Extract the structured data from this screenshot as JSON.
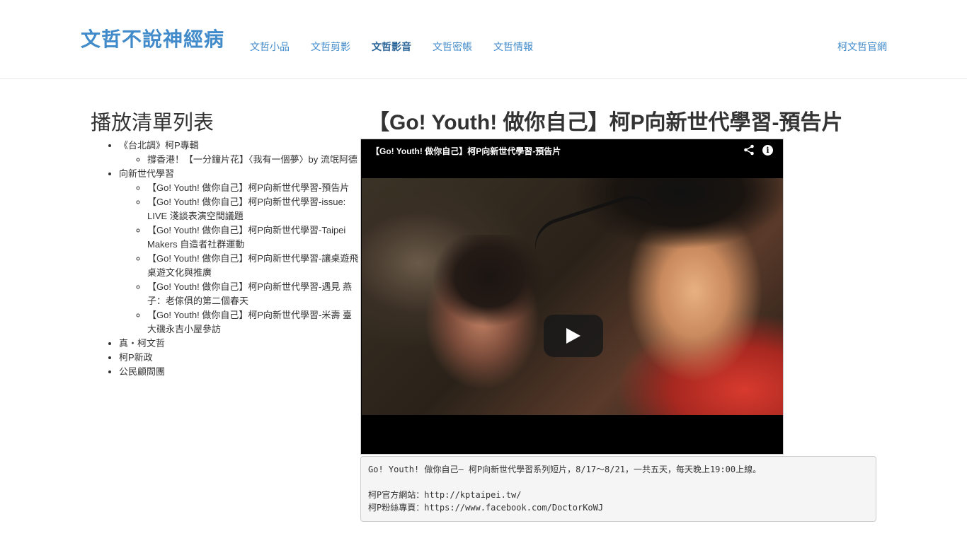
{
  "navbar": {
    "brand": "文哲不說神經病",
    "links": [
      "文哲小品",
      "文哲剪影",
      "文哲影音",
      "文哲密帳",
      "文哲情報"
    ],
    "active_index": 2,
    "right_link": "柯文哲官網"
  },
  "sidebar": {
    "title": "播放清單列表",
    "groups": [
      {
        "label": "《台北調》柯P專輯",
        "items": [
          "撐香港！【一分鐘片花】〈我有一個夢〉by 流氓阿德"
        ]
      },
      {
        "label": "向新世代學習",
        "items": [
          "【Go! Youth! 做你自己】柯P向新世代學習-預告片",
          "【Go! Youth! 做你自己】柯P向新世代學習-issue: LIVE 淺談表演空間議題",
          "【Go! Youth! 做你自己】柯P向新世代學習-Taipei Makers 自造者社群運動",
          "【Go! Youth! 做你自己】柯P向新世代學習-讓桌遊飛 桌遊文化與推廣",
          "【Go! Youth! 做你自己】柯P向新世代學習-遇見 燕子：老傢俱的第二個春天",
          "【Go! Youth! 做你自己】柯P向新世代學習-米壽 臺大磯永吉小屋參訪"
        ]
      },
      {
        "label": "真・柯文哲",
        "items": []
      },
      {
        "label": "柯P新政",
        "items": []
      },
      {
        "label": "公民顧問團",
        "items": []
      }
    ]
  },
  "main": {
    "title": "【Go! Youth! 做你自己】柯P向新世代學習-預告片",
    "player": {
      "title": "【Go! Youth! 做你自己】柯P向新世代學習-預告片",
      "share_icon": "share-icon",
      "info_icon": "info-icon",
      "info_glyph": "i",
      "play_icon": "play-icon"
    },
    "description": {
      "line1": "Go! Youth! 做你自己— 柯P向新世代學習系列短片，8/17〜8/21，一共五天，每天晚上19:00上線。",
      "line2": "",
      "line3": "柯P官方網站：http://kptaipei.tw/",
      "line4": "柯P粉絲專頁：https://www.facebook.com/DoctorKoWJ"
    }
  },
  "colors": {
    "link": "#428bca",
    "active_link": "#2a6496",
    "text": "#333333"
  }
}
